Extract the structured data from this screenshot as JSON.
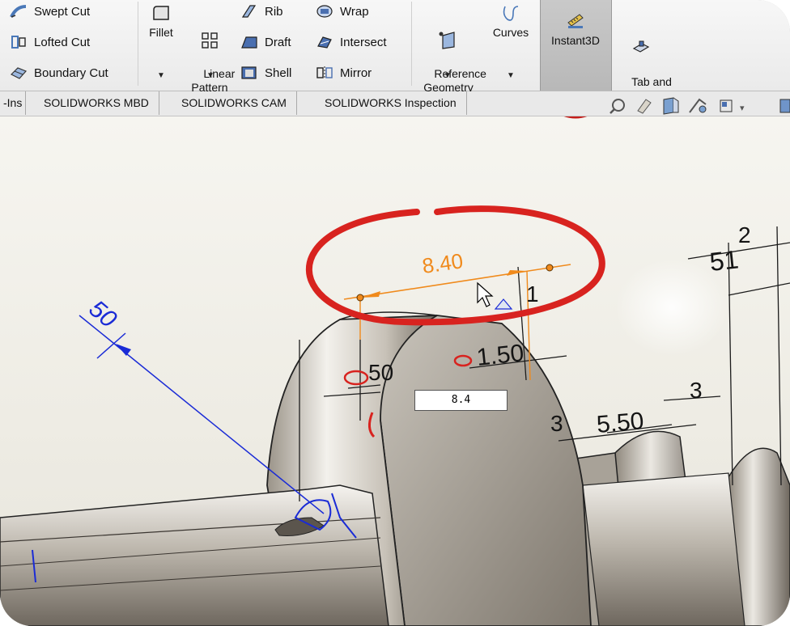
{
  "ribbon": {
    "features_col1": [
      "Swept Cut",
      "Lofted Cut",
      "Boundary Cut"
    ],
    "fillet_label": "Fillet",
    "linear_pattern_label": "Linear\nPattern",
    "features_col3": [
      "Rib",
      "Draft",
      "Shell"
    ],
    "features_col4": [
      "Wrap",
      "Intersect",
      "Mirror"
    ],
    "reference_geometry_label": "Reference\nGeometry",
    "curves_label": "Curves",
    "instant3d_label": "Instant3D",
    "tab_and_slot_label": "Tab and\nSlot",
    "dropdown_glyph": "▼"
  },
  "tabs": [
    "-Ins",
    "SOLIDWORKS MBD",
    "SOLIDWORKS CAM",
    "SOLIDWORKS Inspection"
  ],
  "viewport": {
    "edit_value": "8.4",
    "dimensions": {
      "highlighted": "8.40",
      "angle_blue": "50",
      "d_1": "1",
      "d_1_50": "1.50",
      "d_2": "2",
      "d_51": "51",
      "d_3_right": "3",
      "d_3_left": "3",
      "d_5_50": "5.50",
      "d_50_partial": "50"
    }
  },
  "colors": {
    "highlight_orange": "#f08a1c",
    "annotation_red": "#d8231f",
    "driven_blue": "#1a2bd6",
    "toggle_active_bg": "#bdbdbd"
  }
}
